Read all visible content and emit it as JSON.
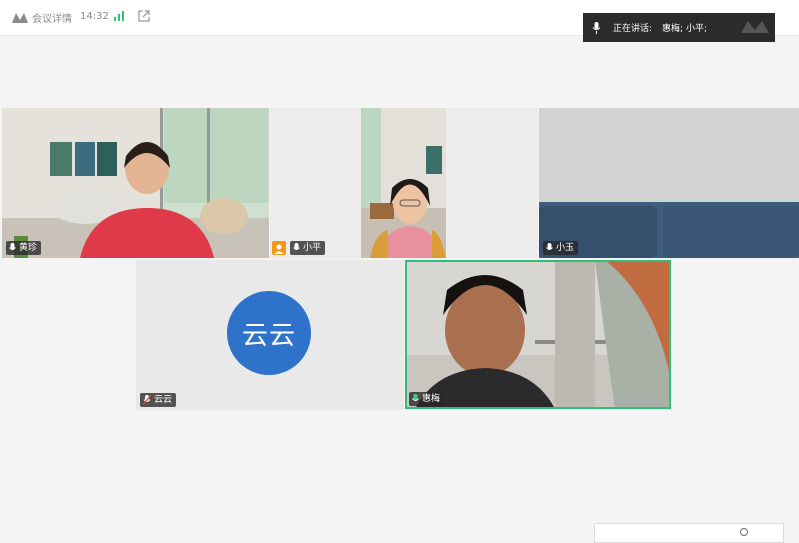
{
  "toolbar": {
    "meeting_details_label": "会议详情",
    "time": "14:32",
    "signal_icon": "signal-bars-icon",
    "share_icon": "external-link-icon"
  },
  "speaking_indicator": {
    "label": "正在讲话:",
    "names": "惠梅; 小平;"
  },
  "participants": [
    {
      "name": "黄珍",
      "mic": "on"
    },
    {
      "name": "小平",
      "mic": "on",
      "host": true
    },
    {
      "name": "小玉",
      "mic": "on"
    },
    {
      "name": "云云",
      "mic": "muted",
      "avatar_text": "云云"
    },
    {
      "name": "惠梅",
      "mic": "speaking",
      "active": true
    }
  ],
  "colors": {
    "avatar_bg": "#2e72c9",
    "active_border": "#2fbf7a",
    "host_badge": "#f39a14"
  }
}
